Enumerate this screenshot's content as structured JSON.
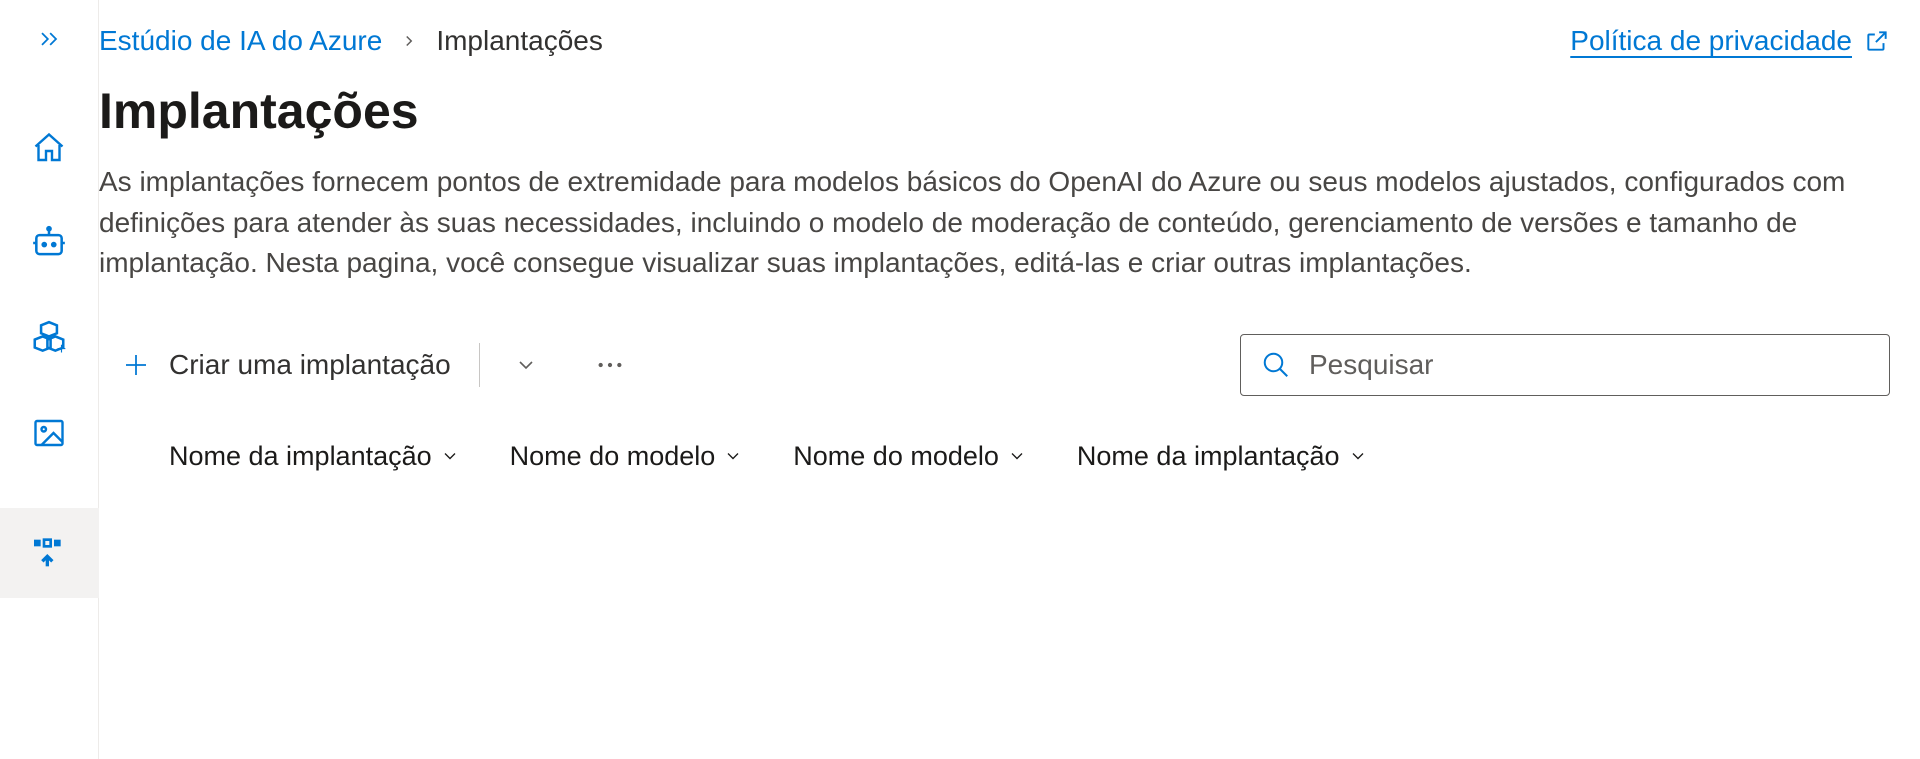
{
  "breadcrumb": {
    "root": "Estúdio de IA do Azure",
    "current": "Implantações"
  },
  "privacy": {
    "label": "Política de privacidade"
  },
  "page": {
    "title": "Implantações",
    "description": "As implantações fornecem pontos de extremidade para modelos básicos do OpenAI do Azure ou seus modelos ajustados, configurados com definições para atender às suas necessidades, incluindo o modelo de moderação de conteúdo, gerenciamento de versões e tamanho de implantação. Nesta pagina, você consegue visualizar suas implantações, editá-las e criar outras implantações."
  },
  "toolbar": {
    "create_label": "Criar uma implantação"
  },
  "search": {
    "placeholder": "Pesquisar"
  },
  "columns": [
    "Nome da implantação",
    "Nome do modelo",
    "Nome do modelo",
    "Nome da implantação"
  ],
  "sidebar": {
    "icons": [
      "expand",
      "home",
      "chat-bot",
      "model-catalog",
      "image",
      "deployments"
    ]
  }
}
